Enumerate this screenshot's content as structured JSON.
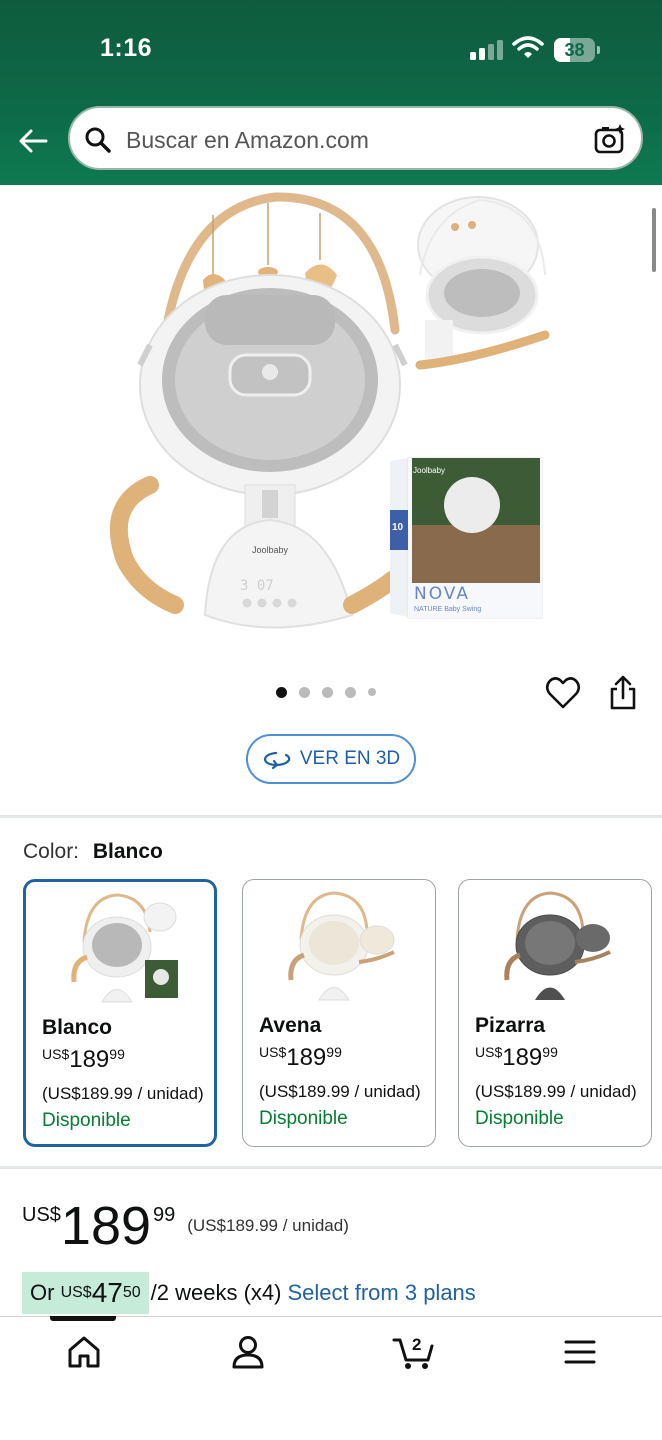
{
  "status_bar": {
    "time": "1:16",
    "battery": "38",
    "battery_level": 0.38
  },
  "header": {
    "search_placeholder": "Buscar en Amazon.com",
    "colors": {
      "bg_top": "#0f5b3e",
      "bg_bottom": "#0e7a52"
    }
  },
  "gallery": {
    "image_count": 5,
    "active_index": 0,
    "box_brand": "Joolbaby",
    "box_product": "NOVA",
    "box_subtitle": "NATURE Baby Swing",
    "box_badge": "10",
    "product_brand": "Joolbaby",
    "display_digits": "3 07"
  },
  "view_3d": {
    "label": "VER EN 3D"
  },
  "color_selector": {
    "label": "Color:",
    "selected": "Blanco",
    "options": [
      {
        "name": "Blanco",
        "currency": "US$",
        "whole": "189",
        "fraction": "99",
        "unit_price": "(US$189.99 / unidad)",
        "availability": "Disponible"
      },
      {
        "name": "Avena",
        "currency": "US$",
        "whole": "189",
        "fraction": "99",
        "unit_price": "(US$189.99 / unidad)",
        "availability": "Disponible"
      },
      {
        "name": "Pizarra",
        "currency": "US$",
        "whole": "189",
        "fraction": "99",
        "unit_price": "(US$189.99 / unidad)",
        "availability": "Disponible"
      }
    ]
  },
  "price": {
    "currency": "US$",
    "whole": "189",
    "fraction": "99",
    "unit_price": "(US$189.99 / unidad)"
  },
  "installment": {
    "prefix": "Or",
    "currency": "US$",
    "whole": "47",
    "fraction": "50",
    "period": "/2 weeks (x4)",
    "link": "Select from 3 plans"
  },
  "tabbar": {
    "cart_count": "2",
    "items": [
      "home-icon",
      "account-icon",
      "cart-icon",
      "menu-icon"
    ]
  },
  "colors": {
    "link_blue": "#2162a1",
    "available_green": "#067d34",
    "highlight_green": "#c6ecd9"
  }
}
